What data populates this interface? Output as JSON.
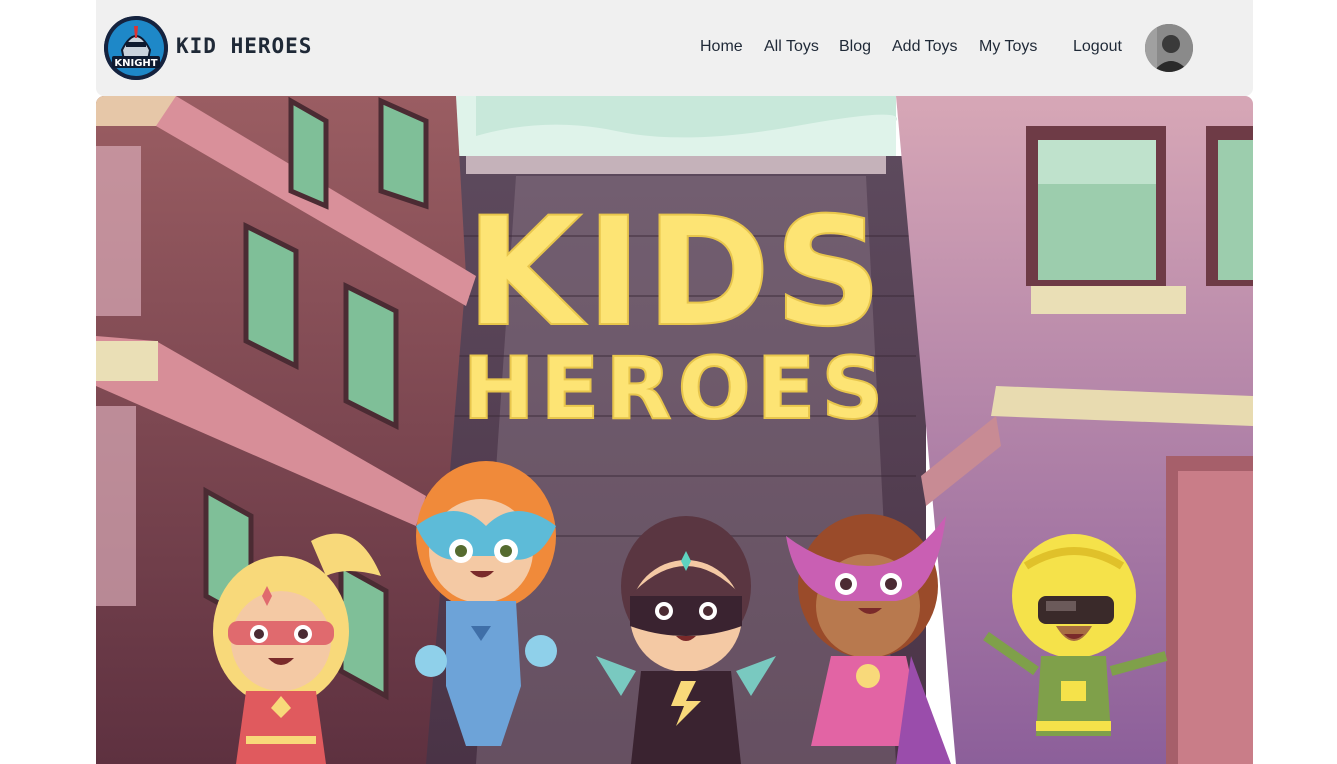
{
  "brand": {
    "name": "KID HEROES",
    "logo_icon": "knight-logo-icon"
  },
  "nav": {
    "links": [
      {
        "label": "Home"
      },
      {
        "label": "All Toys"
      },
      {
        "label": "Blog"
      },
      {
        "label": "Add Toys"
      },
      {
        "label": "My Toys"
      },
      {
        "label": "Logout"
      }
    ],
    "avatar_icon": "user-avatar"
  },
  "hero": {
    "title_line1": "KIDS",
    "title_line2": "HEROES"
  },
  "colors": {
    "navbar_bg": "#f0f0f0",
    "title_yellow": "#fde474",
    "wall_brown": "#7d4b52",
    "wall_pink": "#c98e9e"
  }
}
